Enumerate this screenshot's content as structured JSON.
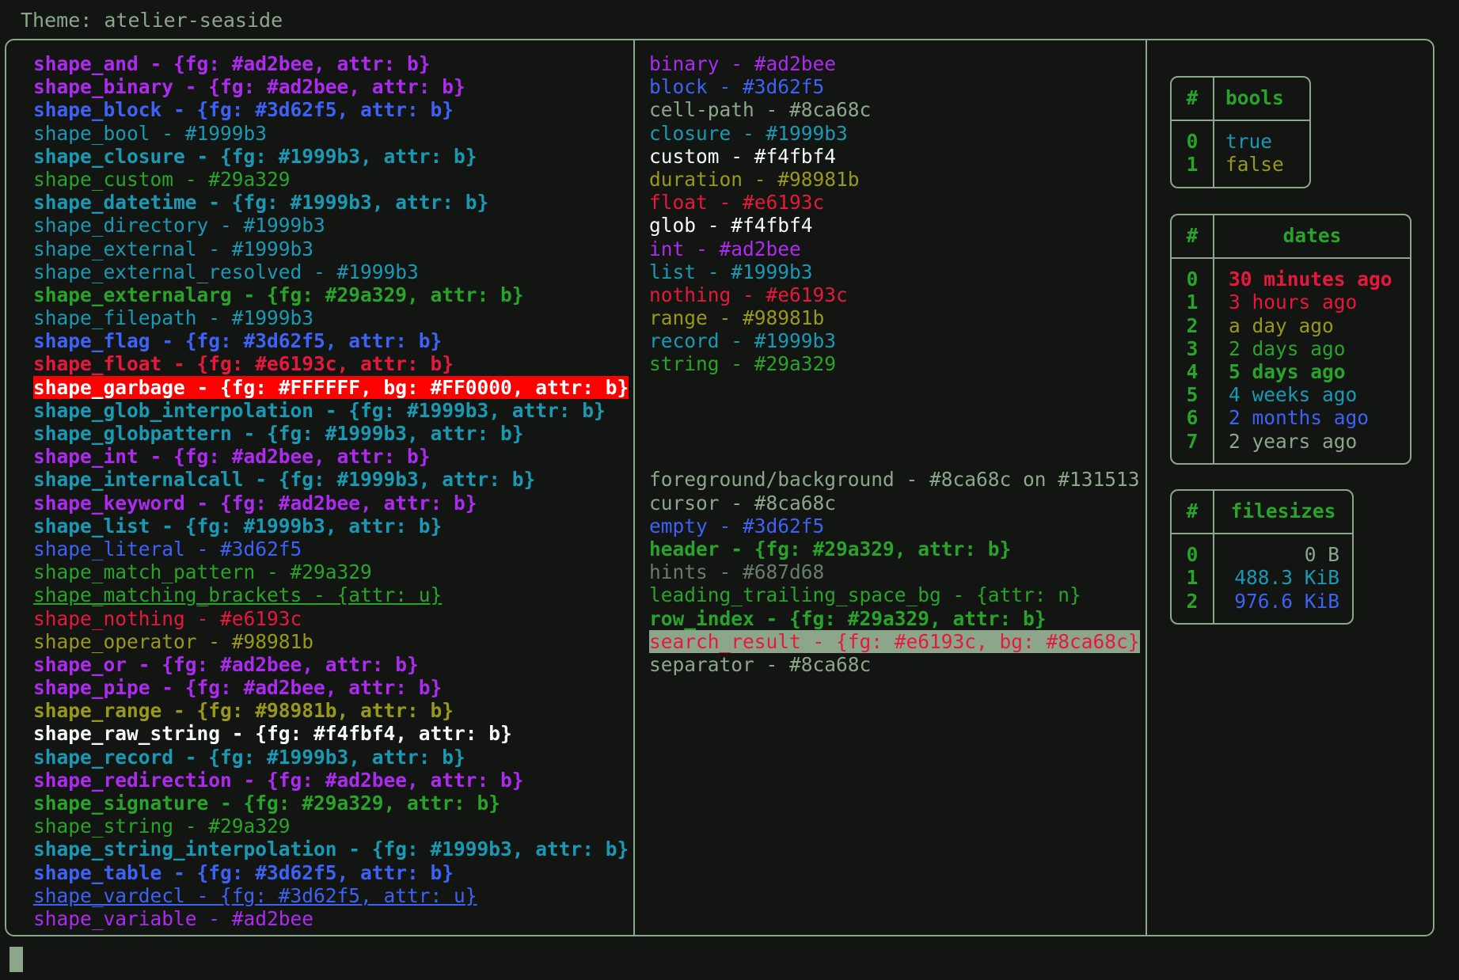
{
  "header": {
    "theme_label": "Theme: atelier-seaside"
  },
  "colors": {
    "background": "#131513",
    "foreground": "#8ca68c",
    "border": "#8ca68c",
    "purple": "#ad2bee",
    "blue": "#3d62f5",
    "cyan": "#1999b3",
    "green": "#29a329",
    "red": "#e6193c",
    "yellow": "#98981b",
    "white": "#f4fbf4",
    "grey": "#687d68",
    "garbage_fg": "#FFFFFF",
    "garbage_bg": "#FF0000",
    "search_result_fg": "#e6193c",
    "search_result_bg": "#8ca68c"
  },
  "shape_column": [
    {
      "text": "shape_and - {fg: #ad2bee, attr: b}",
      "fg": "#ad2bee",
      "bold": true
    },
    {
      "text": "shape_binary - {fg: #ad2bee, attr: b}",
      "fg": "#ad2bee",
      "bold": true
    },
    {
      "text": "shape_block - {fg: #3d62f5, attr: b}",
      "fg": "#3d62f5",
      "bold": true
    },
    {
      "text": "shape_bool - #1999b3",
      "fg": "#1999b3",
      "bold": false
    },
    {
      "text": "shape_closure - {fg: #1999b3, attr: b}",
      "fg": "#1999b3",
      "bold": true
    },
    {
      "text": "shape_custom - #29a329",
      "fg": "#29a329",
      "bold": false
    },
    {
      "text": "shape_datetime - {fg: #1999b3, attr: b}",
      "fg": "#1999b3",
      "bold": true
    },
    {
      "text": "shape_directory - #1999b3",
      "fg": "#1999b3",
      "bold": false
    },
    {
      "text": "shape_external - #1999b3",
      "fg": "#1999b3",
      "bold": false
    },
    {
      "text": "shape_external_resolved - #1999b3",
      "fg": "#1999b3",
      "bold": false
    },
    {
      "text": "shape_externalarg - {fg: #29a329, attr: b}",
      "fg": "#29a329",
      "bold": true
    },
    {
      "text": "shape_filepath - #1999b3",
      "fg": "#1999b3",
      "bold": false
    },
    {
      "text": "shape_flag - {fg: #3d62f5, attr: b}",
      "fg": "#3d62f5",
      "bold": true
    },
    {
      "text": "shape_float - {fg: #e6193c, attr: b}",
      "fg": "#e6193c",
      "bold": true
    },
    {
      "text": "shape_garbage - {fg: #FFFFFF, bg: #FF0000, attr: b}",
      "fg": "#FFFFFF",
      "bg": "#FF0000",
      "bold": true
    },
    {
      "text": "shape_glob_interpolation - {fg: #1999b3, attr: b}",
      "fg": "#1999b3",
      "bold": true
    },
    {
      "text": "shape_globpattern - {fg: #1999b3, attr: b}",
      "fg": "#1999b3",
      "bold": true
    },
    {
      "text": "shape_int - {fg: #ad2bee, attr: b}",
      "fg": "#ad2bee",
      "bold": true
    },
    {
      "text": "shape_internalcall - {fg: #1999b3, attr: b}",
      "fg": "#1999b3",
      "bold": true
    },
    {
      "text": "shape_keyword - {fg: #ad2bee, attr: b}",
      "fg": "#ad2bee",
      "bold": true
    },
    {
      "text": "shape_list - {fg: #1999b3, attr: b}",
      "fg": "#1999b3",
      "bold": true
    },
    {
      "text": "shape_literal - #3d62f5",
      "fg": "#3d62f5",
      "bold": false
    },
    {
      "text": "shape_match_pattern - #29a329",
      "fg": "#29a329",
      "bold": false
    },
    {
      "text": "shape_matching_brackets - {attr: u}",
      "fg": "#29a329",
      "bold": false,
      "underline": true
    },
    {
      "text": "shape_nothing - #e6193c",
      "fg": "#e6193c",
      "bold": false
    },
    {
      "text": "shape_operator - #98981b",
      "fg": "#98981b",
      "bold": false
    },
    {
      "text": "shape_or - {fg: #ad2bee, attr: b}",
      "fg": "#ad2bee",
      "bold": true
    },
    {
      "text": "shape_pipe - {fg: #ad2bee, attr: b}",
      "fg": "#ad2bee",
      "bold": true
    },
    {
      "text": "shape_range - {fg: #98981b, attr: b}",
      "fg": "#98981b",
      "bold": true
    },
    {
      "text": "shape_raw_string - {fg: #f4fbf4, attr: b}",
      "fg": "#f4fbf4",
      "bold": true
    },
    {
      "text": "shape_record - {fg: #1999b3, attr: b}",
      "fg": "#1999b3",
      "bold": true
    },
    {
      "text": "shape_redirection - {fg: #ad2bee, attr: b}",
      "fg": "#ad2bee",
      "bold": true
    },
    {
      "text": "shape_signature - {fg: #29a329, attr: b}",
      "fg": "#29a329",
      "bold": true
    },
    {
      "text": "shape_string - #29a329",
      "fg": "#29a329",
      "bold": false
    },
    {
      "text": "shape_string_interpolation - {fg: #1999b3, attr: b}",
      "fg": "#1999b3",
      "bold": true
    },
    {
      "text": "shape_table - {fg: #3d62f5, attr: b}",
      "fg": "#3d62f5",
      "bold": true
    },
    {
      "text": "shape_vardecl - {fg: #3d62f5, attr: u}",
      "fg": "#3d62f5",
      "bold": false,
      "underline": true
    },
    {
      "text": "shape_variable - #ad2bee",
      "fg": "#ad2bee",
      "bold": false
    }
  ],
  "type_column": [
    {
      "text": "binary - #ad2bee",
      "fg": "#ad2bee",
      "bold": false
    },
    {
      "text": "block - #3d62f5",
      "fg": "#3d62f5",
      "bold": false
    },
    {
      "text": "cell-path - #8ca68c",
      "fg": "#8ca68c",
      "bold": false
    },
    {
      "text": "closure - #1999b3",
      "fg": "#1999b3",
      "bold": false
    },
    {
      "text": "custom - #f4fbf4",
      "fg": "#f4fbf4",
      "bold": false
    },
    {
      "text": "duration - #98981b",
      "fg": "#98981b",
      "bold": false
    },
    {
      "text": "float - #e6193c",
      "fg": "#e6193c",
      "bold": false
    },
    {
      "text": "glob - #f4fbf4",
      "fg": "#f4fbf4",
      "bold": false
    },
    {
      "text": "int - #ad2bee",
      "fg": "#ad2bee",
      "bold": false
    },
    {
      "text": "list - #1999b3",
      "fg": "#1999b3",
      "bold": false
    },
    {
      "text": "nothing - #e6193c",
      "fg": "#e6193c",
      "bold": false
    },
    {
      "text": "range - #98981b",
      "fg": "#98981b",
      "bold": false
    },
    {
      "text": "record - #1999b3",
      "fg": "#1999b3",
      "bold": false
    },
    {
      "text": "string - #29a329",
      "fg": "#29a329",
      "bold": false
    }
  ],
  "ui_column": [
    {
      "text": "foreground/background - #8ca68c on #131513",
      "fg": "#8ca68c",
      "bold": false
    },
    {
      "text": "cursor - #8ca68c",
      "fg": "#8ca68c",
      "bold": false
    },
    {
      "text": "empty - #3d62f5",
      "fg": "#3d62f5",
      "bold": false
    },
    {
      "text": "header - {fg: #29a329, attr: b}",
      "fg": "#29a329",
      "bold": true
    },
    {
      "text": "hints - #687d68",
      "fg": "#687d68",
      "bold": false
    },
    {
      "text": "leading_trailing_space_bg - {attr: n}",
      "fg": "#29a329",
      "bold": false
    },
    {
      "text": "row_index - {fg: #29a329, attr: b}",
      "fg": "#29a329",
      "bold": true
    },
    {
      "text": "search_result - {fg: #e6193c, bg: #8ca68c}",
      "fg": "#e6193c",
      "bg": "#8ca68c",
      "bold": false
    },
    {
      "text": "separator - #8ca68c",
      "fg": "#8ca68c",
      "bold": false
    }
  ],
  "tables": {
    "bools": {
      "columns": [
        "#",
        "bools"
      ],
      "rows": [
        {
          "index": "0",
          "value": "true",
          "fg": "#1999b3",
          "bold": false
        },
        {
          "index": "1",
          "value": "false",
          "fg": "#98981b",
          "bold": false
        }
      ]
    },
    "dates": {
      "columns": [
        "#",
        "dates"
      ],
      "rows": [
        {
          "index": "0",
          "value": "30 minutes ago",
          "fg": "#e6193c",
          "bold": true
        },
        {
          "index": "1",
          "value": "3 hours ago",
          "fg": "#e6193c",
          "bold": false
        },
        {
          "index": "2",
          "value": "a day ago",
          "fg": "#98981b",
          "bold": false
        },
        {
          "index": "3",
          "value": "2 days ago",
          "fg": "#29a329",
          "bold": false
        },
        {
          "index": "4",
          "value": "5 days ago",
          "fg": "#29a329",
          "bold": true
        },
        {
          "index": "5",
          "value": "4 weeks ago",
          "fg": "#1999b3",
          "bold": false
        },
        {
          "index": "6",
          "value": "2 months ago",
          "fg": "#3d62f5",
          "bold": false
        },
        {
          "index": "7",
          "value": "2 years ago",
          "fg": "#8ca68c",
          "bold": false
        }
      ]
    },
    "filesizes": {
      "columns": [
        "#",
        "filesizes"
      ],
      "rows": [
        {
          "index": "0",
          "value": "0 B",
          "fg": "#8ca68c",
          "bold": false
        },
        {
          "index": "1",
          "value": "488.3 KiB",
          "fg": "#1999b3",
          "bold": false
        },
        {
          "index": "2",
          "value": "976.6 KiB",
          "fg": "#3d62f5",
          "bold": false
        }
      ]
    }
  }
}
